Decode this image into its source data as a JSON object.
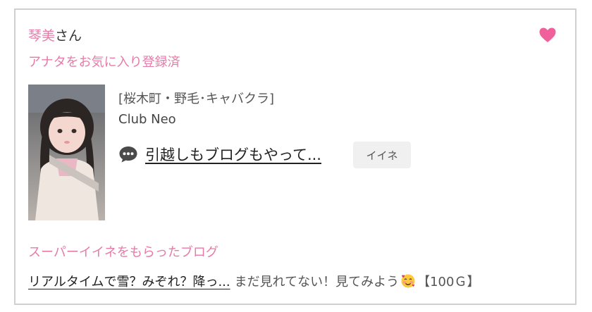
{
  "header": {
    "name": "琴美",
    "suffix": "さん",
    "favorite_status": "アナタをお気に入り登録済"
  },
  "profile": {
    "area": "[桜木町・野毛･キャバクラ]",
    "club": "Club Neo"
  },
  "latest_blog": {
    "title": "引越しもブログもやって...",
    "iine_label": "イイネ"
  },
  "super_iine": {
    "section_title": "スーパーイイネをもらったブログ",
    "blog_title": "リアルタイムで雪？みぞれ？降っ...",
    "comment": "まだ見れてない！見てみよう",
    "points": "【100Ｇ】"
  },
  "colors": {
    "accent_pink": "#e77aa8",
    "heart": "#f0609a"
  },
  "icons": {
    "favorite": "heart-icon",
    "blog": "speech-bubble-icon",
    "emoji": "smiling-face-with-hearts"
  }
}
